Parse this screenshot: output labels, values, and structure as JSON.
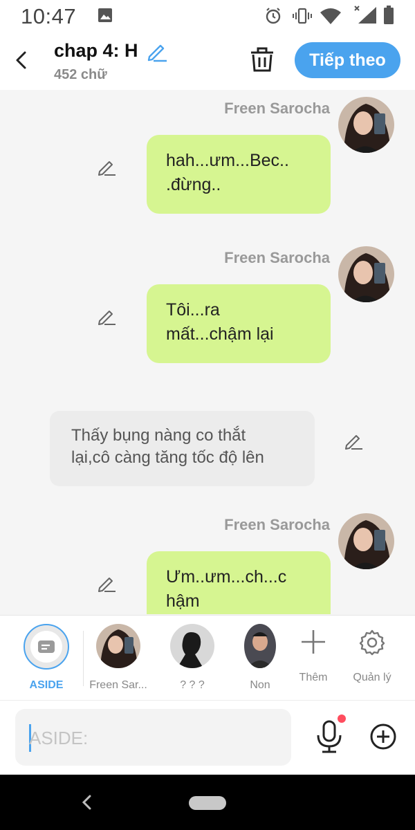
{
  "status_bar": {
    "time": "10:47"
  },
  "header": {
    "title": "chap 4: H",
    "word_count": "452 chữ",
    "next_label": "Tiếp theo"
  },
  "messages": [
    {
      "sender": "Freen Sarocha",
      "line1": "hah...ưm...Bec..",
      "line2": ".đừng.."
    },
    {
      "sender": "Freen Sarocha",
      "line1": "Tôi...ra",
      "line2": "mất...chậm lại"
    },
    {
      "sender": "Freen Sarocha",
      "line1": "Ưm..ưm...ch...c",
      "line2": "hậm"
    }
  ],
  "narration": {
    "line1": "Thấy bụng nàng co thắt",
    "line2": "lại,cô càng tăng tốc độ lên"
  },
  "characters": {
    "aside": "ASIDE",
    "char1": "Freen Sar...",
    "char2": "? ? ?",
    "char3": "Non",
    "add": "Thêm",
    "manage": "Quản lý"
  },
  "input": {
    "placeholder": "ASIDE:"
  },
  "colors": {
    "accent": "#4aa3ee",
    "bubble": "#d6f591",
    "narration_bg": "#ececec"
  }
}
